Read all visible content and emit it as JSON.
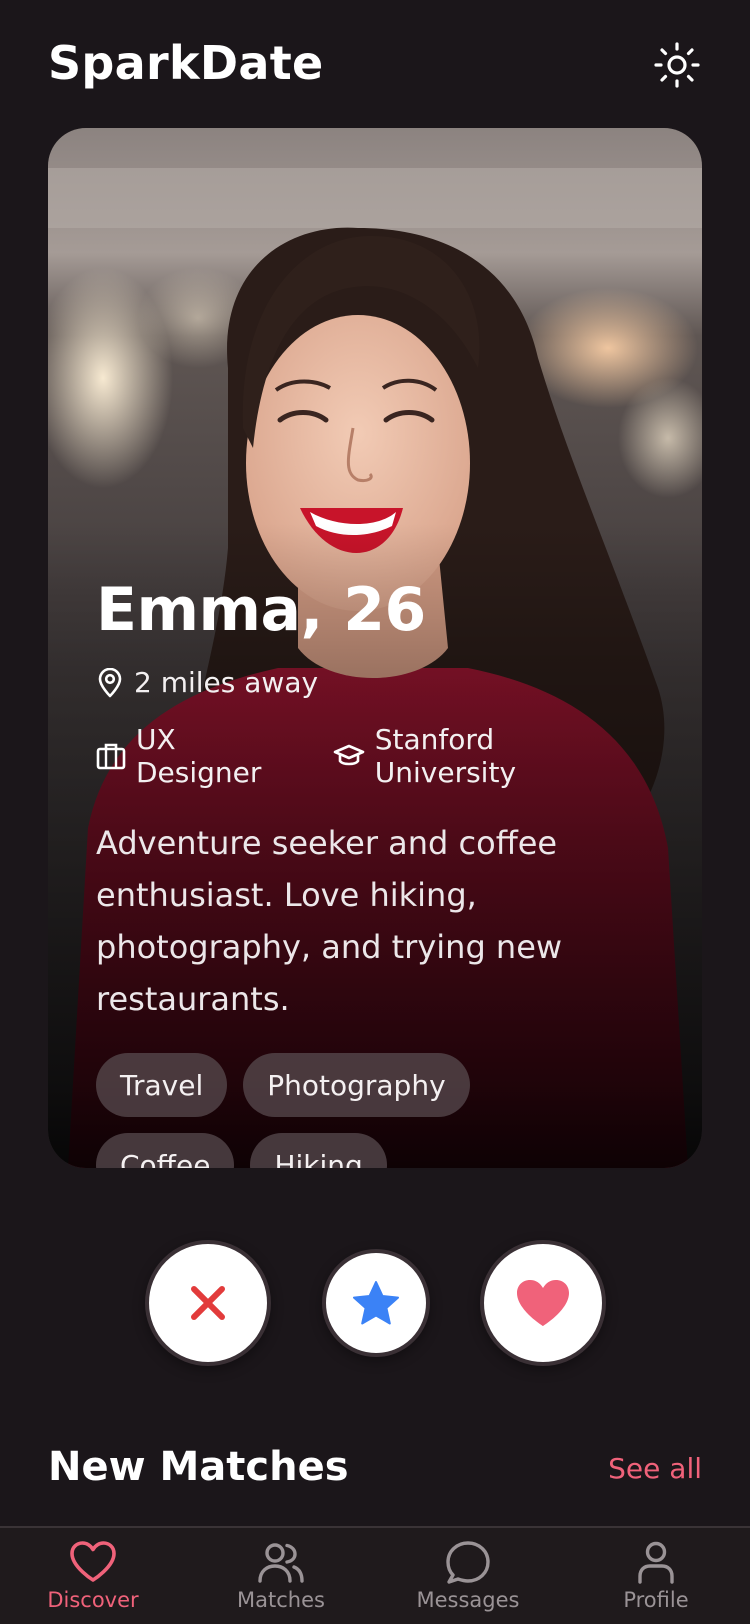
{
  "app": {
    "title": "SparkDate"
  },
  "profile": {
    "name_age": "Emma, 26",
    "distance": "2 miles away",
    "job": "UX Designer",
    "school": "Stanford University",
    "bio": "Adventure seeker and coffee enthusiast. Love hiking, photography, and trying new restaurants.",
    "interests": [
      "Travel",
      "Photography",
      "Coffee",
      "Hiking"
    ]
  },
  "sections": {
    "new_matches_title": "New Matches",
    "see_all": "See all"
  },
  "nav": {
    "items": [
      {
        "label": "Discover",
        "icon": "heart-icon",
        "active": true
      },
      {
        "label": "Matches",
        "icon": "users-icon",
        "active": false
      },
      {
        "label": "Messages",
        "icon": "chat-bubble-icon",
        "active": false
      },
      {
        "label": "Profile",
        "icon": "user-icon",
        "active": false
      }
    ]
  },
  "colors": {
    "background": "#1b161a",
    "accent": "#f0627a",
    "nope": "#e23b3b",
    "super_like": "#3b82f6",
    "like": "#f0627a"
  }
}
